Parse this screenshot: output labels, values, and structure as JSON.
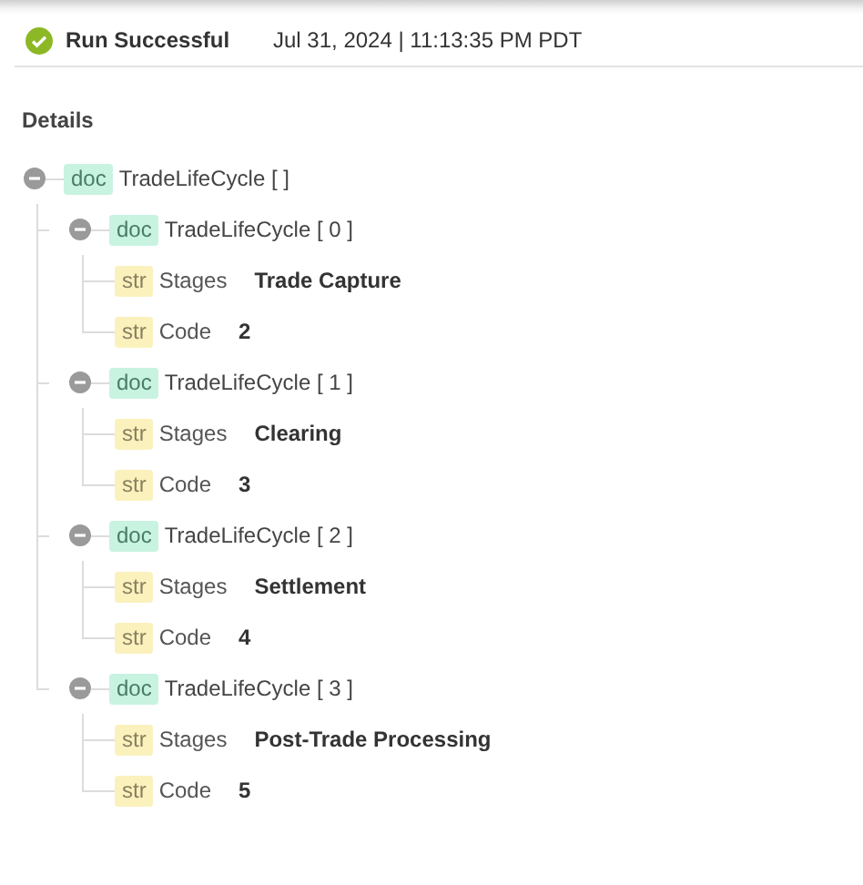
{
  "header": {
    "status": {
      "label": "Run Successful"
    },
    "timestamp": "Jul 31, 2024 | 11:13:35 PM PDT"
  },
  "section_title": "Details",
  "tree": [
    {
      "kind": "doc",
      "label": "TradeLifeCycle [ ]",
      "expanded": true,
      "children": [
        {
          "kind": "doc",
          "label": "TradeLifeCycle [ 0 ]",
          "expanded": true,
          "children": [
            {
              "kind": "str",
              "key": "Stages",
              "value": "Trade Capture"
            },
            {
              "kind": "str",
              "key": "Code",
              "value": "2"
            }
          ]
        },
        {
          "kind": "doc",
          "label": "TradeLifeCycle [ 1 ]",
          "expanded": true,
          "children": [
            {
              "kind": "str",
              "key": "Stages",
              "value": "Clearing"
            },
            {
              "kind": "str",
              "key": "Code",
              "value": "3"
            }
          ]
        },
        {
          "kind": "doc",
          "label": "TradeLifeCycle [ 2 ]",
          "expanded": true,
          "children": [
            {
              "kind": "str",
              "key": "Stages",
              "value": "Settlement"
            },
            {
              "kind": "str",
              "key": "Code",
              "value": "4"
            }
          ]
        },
        {
          "kind": "doc",
          "label": "TradeLifeCycle [ 3 ]",
          "expanded": true,
          "children": [
            {
              "kind": "str",
              "key": "Stages",
              "value": "Post-Trade Processing"
            },
            {
              "kind": "str",
              "key": "Code",
              "value": "5"
            }
          ]
        }
      ]
    }
  ]
}
